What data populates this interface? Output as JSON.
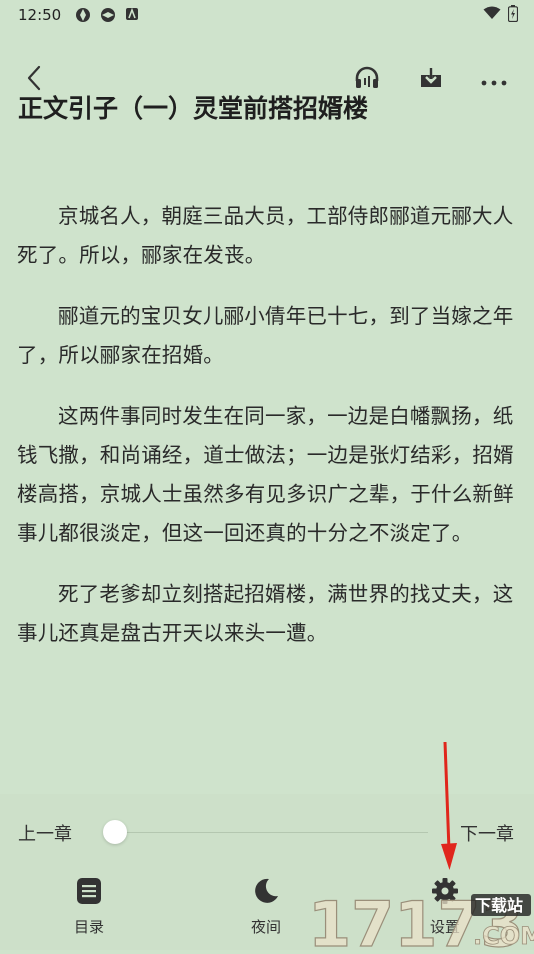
{
  "status_bar": {
    "time": "12:50"
  },
  "chapter": {
    "title": "正文引子（一）灵堂前搭招婿楼"
  },
  "paragraphs": [
    "京城名人，朝庭三品大员，工部侍郎郦道元郦大人死了。所以，郦家在发丧。",
    "郦道元的宝贝女儿郦小倩年已十七，到了当嫁之年了，所以郦家在招婚。",
    "这两件事同时发生在同一家，一边是白幡飘扬，纸钱飞撒，和尚诵经，道士做法；一边是张灯结彩，招婿楼高搭，京城人士虽然多有见多识广之辈，于什么新鲜事儿都很淡定，但这一回还真的十分之不淡定了。",
    "死了老爹却立刻搭起招婿楼，满世界的找丈夫，这事儿还真是盘古开天以来头一遭。"
  ],
  "reader_controls": {
    "prev_chapter": "上一章",
    "next_chapter": "下一章",
    "progress": 0
  },
  "bottom_tabs": {
    "catalog": "目录",
    "night": "夜间",
    "settings": "设置"
  },
  "icons": {
    "back": "back-arrow-icon",
    "listen": "headphones-icon",
    "download": "download-icon",
    "more": "more-icon",
    "catalog": "catalog-icon",
    "night": "moon-icon",
    "settings": "settings-icon"
  },
  "watermark": {
    "number": "17173",
    "tag": "下载站",
    "suffix": ".COM"
  },
  "colors": {
    "background": "#cfe3cc",
    "panel": "#cde0c9",
    "text": "#2a2a2a",
    "annotation_arrow": "#e0261c"
  }
}
